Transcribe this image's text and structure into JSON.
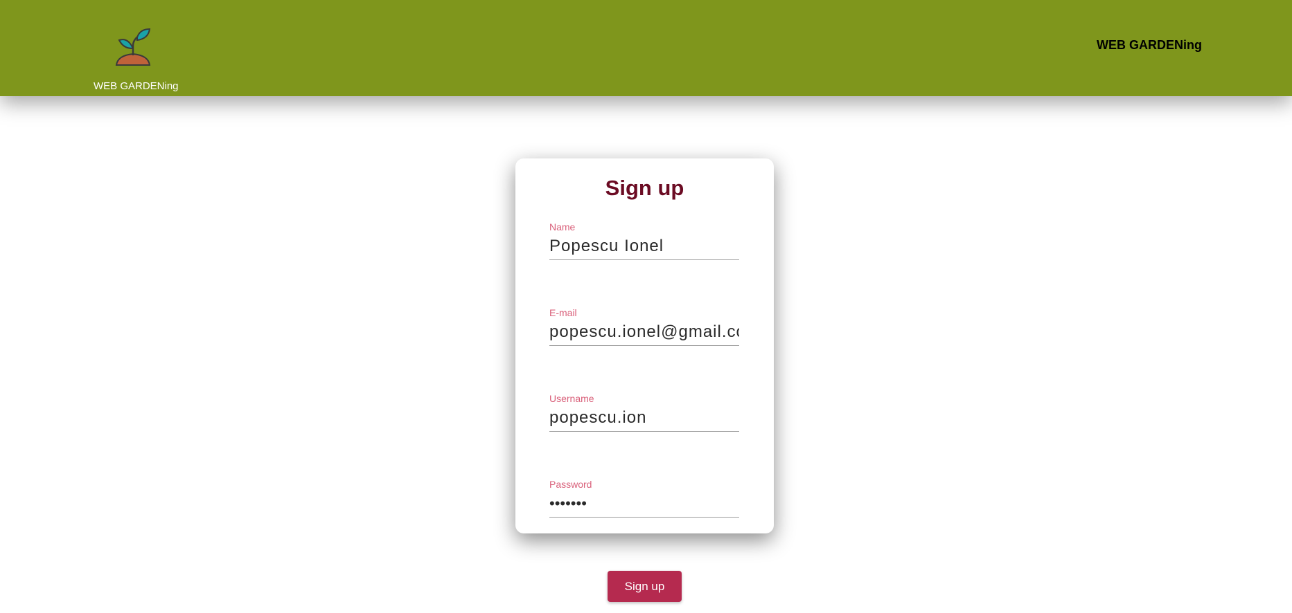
{
  "header": {
    "brand_text": "WEB GARDENing",
    "nav_title": "WEB GARDENing",
    "background_color": "#7f961c",
    "logo_icon": "sprout-icon"
  },
  "form": {
    "title": "Sign up",
    "title_color": "#6b0b23",
    "label_color": "#d9607a",
    "fields": [
      {
        "label": "Name",
        "value": "Popescu Ionel"
      },
      {
        "label": "E-mail",
        "value": "popescu.ionel@gmail.com"
      },
      {
        "label": "Username",
        "value": "popescu.ion"
      },
      {
        "label": "Password",
        "value": "secret1"
      }
    ],
    "submit_label": "Sign up",
    "submit_color": "#b52a4f"
  }
}
